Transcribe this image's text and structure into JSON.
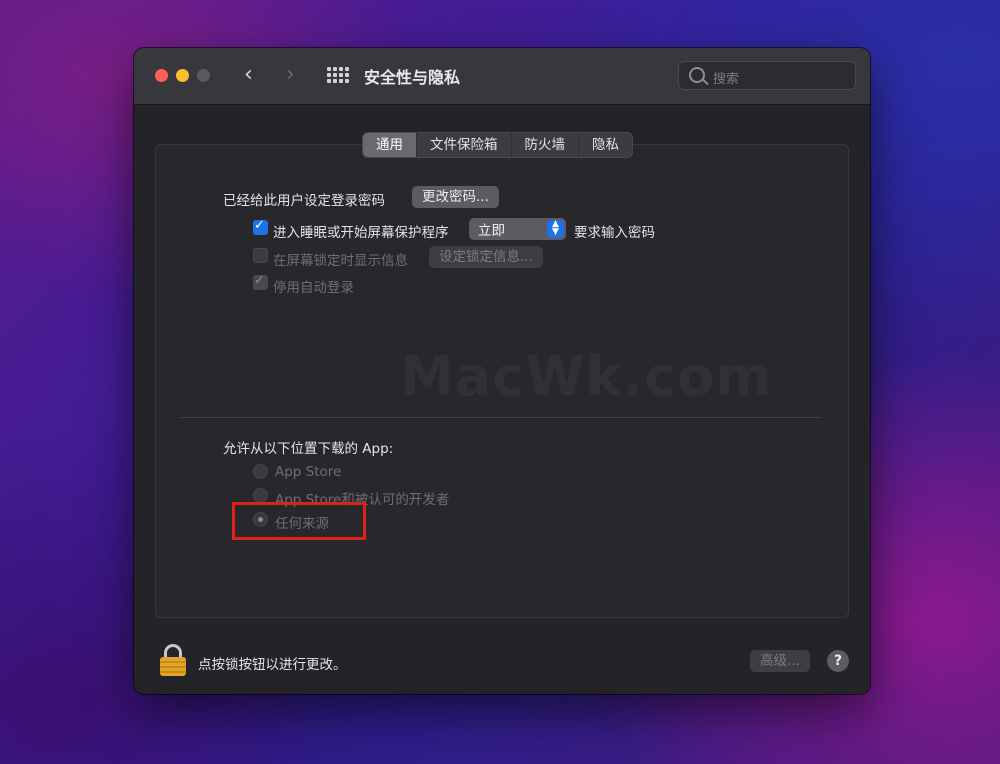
{
  "window": {
    "title": "安全性与隐私",
    "search_placeholder": "搜索"
  },
  "tabs": [
    {
      "label": "通用",
      "active": true
    },
    {
      "label": "文件保险箱",
      "active": false
    },
    {
      "label": "防火墙",
      "active": false
    },
    {
      "label": "隐私",
      "active": false
    }
  ],
  "general": {
    "password_set_label": "已经给此用户设定登录密码",
    "change_password_button": "更改密码...",
    "require_password": {
      "checked": true,
      "label": "进入睡眠或开始屏幕保护程序",
      "select_value": "立即",
      "suffix": "要求输入密码"
    },
    "show_message": {
      "checked": false,
      "label": "在屏幕锁定时显示信息",
      "button": "设定锁定信息..."
    },
    "disable_auto_login": {
      "checked": true,
      "label": "停用自动登录"
    }
  },
  "downloads": {
    "heading": "允许从以下位置下载的 App:",
    "options": [
      {
        "label": "App Store",
        "selected": false
      },
      {
        "label": "App Store和被认可的开发者",
        "selected": false
      },
      {
        "label": "任何来源",
        "selected": true
      }
    ]
  },
  "watermark": "MacWk.com",
  "footer": {
    "lock_text": "点按锁按钮以进行更改。",
    "advanced_button": "高级...",
    "help_button": "?"
  },
  "colors": {
    "accent": "#1e72e8",
    "highlight": "#e0211a",
    "lock": "#e3a42a"
  }
}
